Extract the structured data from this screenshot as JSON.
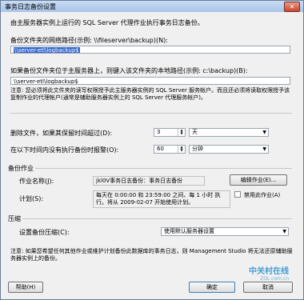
{
  "window": {
    "title": "事务日志备份设置",
    "close_label": "✕"
  },
  "intro": "由主服务器实例上运行的 SQL Server 代理作业执行事务日志备份。",
  "network_path": {
    "label": "备份文件夹的网络路径(示例: \\\\fileserver\\backup)(N):",
    "value": "\\\\server-etl\\logbackup$"
  },
  "local_path": {
    "label": "如果备份文件夹位于主服务器上，则键入该文件夹的本地路径(示例: c:\\backup)(B):",
    "value": "\\\\server-etl\\logbackup$"
  },
  "note1": "注意: 您必须将此文件夹的读写权限授予此主服务器实例的 SQL Server 服务帐户。而且还必须将读取权限授予该复制作业的代理帐户(通常是辅助服务器实例上的 SQL Server 代理服务帐户)。",
  "delete_files": {
    "label": "删除文件，如果其保留时间超过(D):",
    "value": "3",
    "unit": "天"
  },
  "alert": {
    "label": "在以下时间内没有执行备份时报警(O):",
    "value": "60",
    "unit": "分钟"
  },
  "backup_job": {
    "section": "备份作业",
    "name_label": "作业名称(J):",
    "name_value": "jkl0V事务日志备份：事务日志备份",
    "edit_button": "编辑作业(E)...",
    "schedule_label": "计划(S):",
    "schedule_value": "每天在 0:00:00 和 23:59:00 之间、每 1 小时 执行。将从 2009-02-07 开始使用计划。",
    "disable_label": "禁用此作业(A)"
  },
  "compression": {
    "section": "压缩",
    "label": "设置备份压缩(C):",
    "value": "使用默认服务器设置"
  },
  "note2": "注意: 如果您希望任何其他作业或维护计划备份此数据库的事务日志，则 Management Studio 将无法还原辅助服务器实例上的备份。",
  "footer": {
    "help": "帮助(H)",
    "ok": "确定",
    "cancel": "取消"
  },
  "watermark": {
    "main": "中关村在线",
    "sub": "ZOL.com.cn"
  }
}
